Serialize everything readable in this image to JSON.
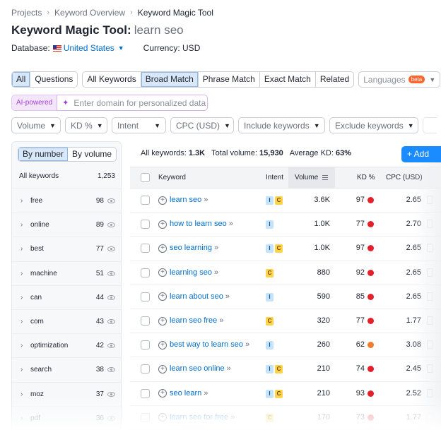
{
  "breadcrumb": [
    "Projects",
    "Keyword Overview",
    "Keyword Magic Tool"
  ],
  "header": {
    "tool": "Keyword Magic Tool:",
    "query": "learn seo"
  },
  "database": {
    "label": "Database:",
    "value": "United States",
    "currency": "Currency: USD"
  },
  "match_tabs": {
    "left": [
      "All",
      "Questions"
    ],
    "right": [
      "All Keywords",
      "Broad Match",
      "Phrase Match",
      "Exact Match",
      "Related"
    ],
    "active_left": "All",
    "active_right": "Broad Match"
  },
  "languages": {
    "label": "Languages",
    "badge": "beta"
  },
  "ai": {
    "label": "AI-powered",
    "placeholder": "Enter domain for personalized data"
  },
  "filters": [
    "Volume",
    "KD %",
    "Intent",
    "CPC (USD)",
    "Include keywords",
    "Exclude keywords"
  ],
  "groups": {
    "toggle": [
      "By number",
      "By volume"
    ],
    "header_label": "All keywords",
    "header_count": "1,253",
    "items": [
      {
        "name": "free",
        "count": "98"
      },
      {
        "name": "online",
        "count": "89"
      },
      {
        "name": "best",
        "count": "77"
      },
      {
        "name": "machine",
        "count": "51"
      },
      {
        "name": "can",
        "count": "44"
      },
      {
        "name": "com",
        "count": "43"
      },
      {
        "name": "optimization",
        "count": "42"
      },
      {
        "name": "search",
        "count": "38"
      },
      {
        "name": "moz",
        "count": "37"
      },
      {
        "name": "pdf",
        "count": "36"
      }
    ]
  },
  "summary": {
    "all_label": "All keywords:",
    "all_value": "1.3K",
    "vol_label": "Total volume:",
    "vol_value": "15,930",
    "kd_label": "Average KD:",
    "kd_value": "63%"
  },
  "add_button": "+ Add",
  "table": {
    "headers": {
      "keyword": "Keyword",
      "intent": "Intent",
      "volume": "Volume",
      "kd": "KD %",
      "cpc": "CPC (USD)"
    },
    "rows": [
      {
        "keyword": "learn seo",
        "intents": [
          "I",
          "C"
        ],
        "volume": "3.6K",
        "kd": "97",
        "kd_color": "#e5202a",
        "cpc": "2.65"
      },
      {
        "keyword": "how to learn seo",
        "intents": [
          "I"
        ],
        "volume": "1.0K",
        "kd": "77",
        "kd_color": "#e5202a",
        "cpc": "2.70"
      },
      {
        "keyword": "seo learning",
        "intents": [
          "I",
          "C"
        ],
        "volume": "1.0K",
        "kd": "97",
        "kd_color": "#e5202a",
        "cpc": "2.65"
      },
      {
        "keyword": "learning seo",
        "intents": [
          "C"
        ],
        "volume": "880",
        "kd": "92",
        "kd_color": "#e5202a",
        "cpc": "2.65"
      },
      {
        "keyword": "learn about seo",
        "intents": [
          "I"
        ],
        "volume": "590",
        "kd": "85",
        "kd_color": "#e5202a",
        "cpc": "2.65"
      },
      {
        "keyword": "learn seo free",
        "intents": [
          "C"
        ],
        "volume": "320",
        "kd": "77",
        "kd_color": "#e5202a",
        "cpc": "1.77"
      },
      {
        "keyword": "best way to learn seo",
        "intents": [
          "I"
        ],
        "volume": "260",
        "kd": "62",
        "kd_color": "#f07d2d",
        "cpc": "3.08"
      },
      {
        "keyword": "learn seo online",
        "intents": [
          "I",
          "C"
        ],
        "volume": "210",
        "kd": "74",
        "kd_color": "#e5202a",
        "cpc": "2.45"
      },
      {
        "keyword": "seo learn",
        "intents": [
          "I",
          "C"
        ],
        "volume": "210",
        "kd": "93",
        "kd_color": "#e5202a",
        "cpc": "2.52"
      },
      {
        "keyword": "learn seo for free",
        "intents": [
          "C"
        ],
        "volume": "170",
        "kd": "73",
        "kd_color": "#e5202a",
        "cpc": "1.77"
      }
    ]
  }
}
